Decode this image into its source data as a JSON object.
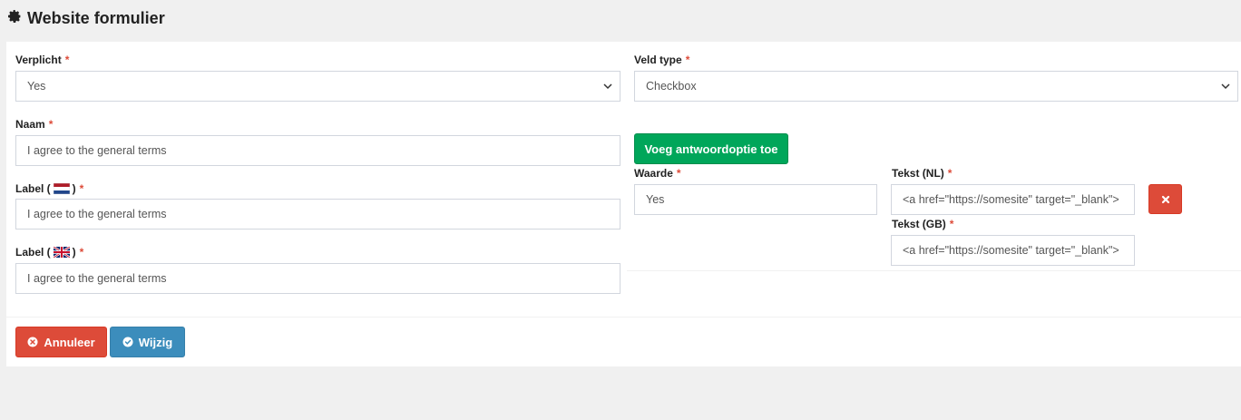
{
  "header": {
    "title": "Website formulier",
    "icon": "gear-icon"
  },
  "form": {
    "required_marker": "*",
    "verplicht": {
      "label": "Verplicht",
      "value": "Yes"
    },
    "naam": {
      "label": "Naam",
      "value": "I agree to the general terms"
    },
    "label_nl": {
      "prefix": "Label (",
      "suffix": ")",
      "value": "I agree to the general terms"
    },
    "label_gb": {
      "prefix": "Label (",
      "suffix": ")",
      "value": "I agree to the general terms"
    },
    "veld_type": {
      "label": "Veld type",
      "value": "Checkbox"
    },
    "add_option_button": "Voeg antwoordoptie toe",
    "option": {
      "waarde_label": "Waarde",
      "waarde_value": "Yes",
      "tekst_nl_label": "Tekst (NL)",
      "tekst_nl_value": "<a href=\"https://somesite\" target=\"_blank\">",
      "tekst_gb_label": "Tekst (GB)",
      "tekst_gb_value": "<a href=\"https://somesite\" target=\"_blank\">"
    }
  },
  "footer": {
    "cancel_label": "Annuleer",
    "save_label": "Wijzig"
  },
  "colors": {
    "required": "#dd4b39",
    "add_button": "#00a65a",
    "cancel_button": "#dd4b39",
    "save_button": "#3c8dbc"
  }
}
